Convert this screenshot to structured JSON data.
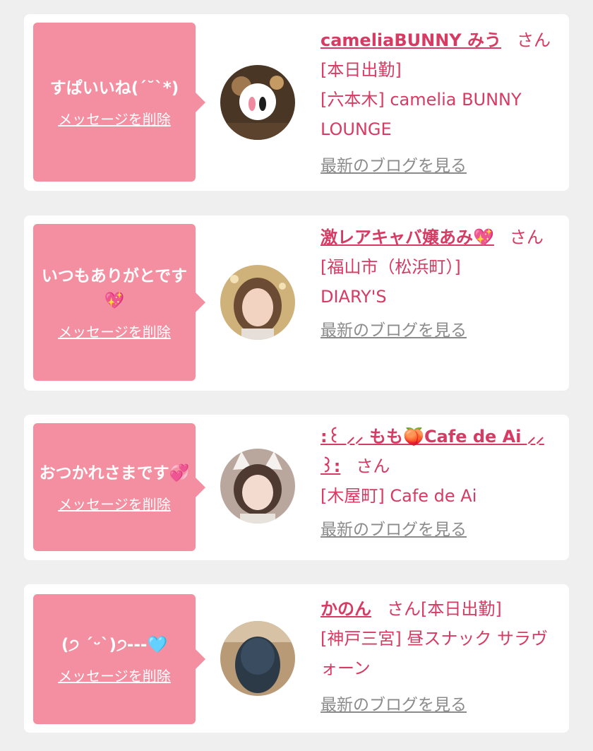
{
  "items": [
    {
      "message": "すぱいいね(ˊ˘ˋ*)",
      "delete_label": "メッセージを削除",
      "name": "cameliaBUNNY みう",
      "honorific": "さん",
      "status": "[本日出勤]",
      "location": "[六本木] camelia BUNNY LOUNGE",
      "blog_link": "最新のブログを見る",
      "avatar_icon": "avatar-photo-icon",
      "avatar_color": "#3b2a1d"
    },
    {
      "message": "いつもありがとです💖",
      "delete_label": "メッセージを削除",
      "name": "激レアキャバ嬢あみ💖",
      "honorific": "さん",
      "status": "",
      "location": "[福山市（松浜町）] DIARY'S",
      "blog_link": "最新のブログを見る",
      "avatar_icon": "avatar-photo-icon",
      "avatar_color": "#c9a66b"
    },
    {
      "message": "おつかれさまです💞",
      "delete_label": "メッセージを削除",
      "name": ":꒰ ⸝⸝ もも🍑Cafe de Ai ⸝⸝ ꒱:",
      "honorific": "さん",
      "status": "",
      "location": "[木屋町] Cafe de Ai",
      "blog_link": "最新のブログを見る",
      "avatar_icon": "avatar-photo-icon",
      "avatar_color": "#8a6f62"
    },
    {
      "message": "(੭ ˊᵕˋ)੭---🩵",
      "delete_label": "メッセージを削除",
      "name": "かのん",
      "honorific": "さん",
      "status": "[本日出勤]",
      "location": "[神戸三宮] 昼スナック サラヴォーン",
      "blog_link": "最新のブログを見る",
      "avatar_icon": "avatar-photo-icon",
      "avatar_color": "#3f4b57"
    }
  ]
}
